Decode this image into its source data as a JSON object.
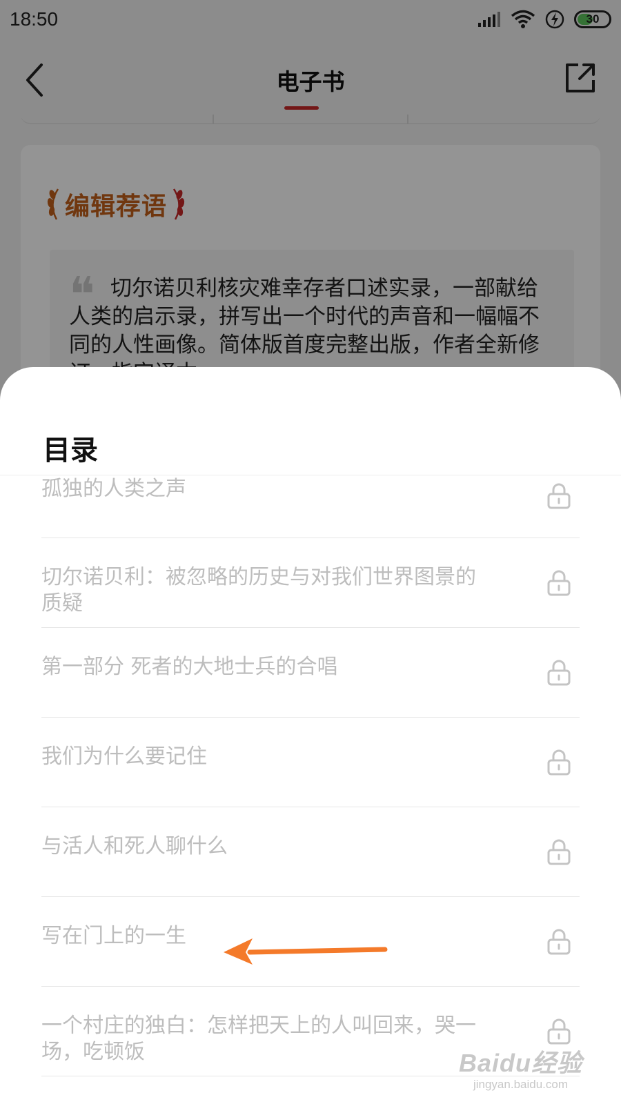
{
  "status_bar": {
    "time": "18:50",
    "battery_level": "30",
    "icons": [
      "signal-icon",
      "wifi-icon",
      "charging-icon",
      "battery-icon"
    ]
  },
  "nav": {
    "title": "电子书",
    "back_icon": "chevron-left-icon",
    "share_icon": "share-icon"
  },
  "editor_recommendation": {
    "badge": "编辑荐语",
    "quote": "切尔诺贝利核灾难幸存者口述实录，一部献给人类的启示录，拼写出一个时代的声音和一幅幅不同的人性画像。简体版首度完整出版，作者全新修订，指定译本"
  },
  "toc": {
    "title": "目录",
    "items": [
      {
        "label": "孤独的人类之声",
        "locked": true
      },
      {
        "label": "切尔诺贝利：被忽略的历史与对我们世界图景的质疑",
        "locked": true
      },
      {
        "label": "第一部分 死者的大地士兵的合唱",
        "locked": true
      },
      {
        "label": "我们为什么要记住",
        "locked": true
      },
      {
        "label": "与活人和死人聊什么",
        "locked": true
      },
      {
        "label": "写在门上的一生",
        "locked": true
      },
      {
        "label": "一个村庄的独白：怎样把天上的人叫回来，哭一场，吃顿饭",
        "locked": true
      }
    ]
  },
  "annotation": {
    "arrow_color": "#f47a2a"
  },
  "watermark": {
    "brand": "Baidu经验",
    "domain": "jingyan.baidu.com"
  },
  "colors": {
    "accent_red": "#c62828",
    "badge_orange": "#c2601a",
    "item_text": "#bdbdbd"
  }
}
